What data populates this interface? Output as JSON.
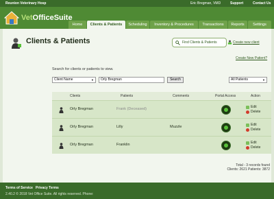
{
  "topbar": {
    "hospital": "Reunion Veterinary Hosp",
    "user": "Eric Bregman, VMD",
    "support": "Support",
    "contact": "Contact Us"
  },
  "brand": {
    "logo_text_a": "Vet",
    "logo_text_b": "OfficeSuite",
    "accent": "#4f8a34"
  },
  "tabs": [
    {
      "label": "Home"
    },
    {
      "label": "Clients & Patients",
      "active": true
    },
    {
      "label": "Scheduling"
    },
    {
      "label": "Inventory & Procedures"
    },
    {
      "label": "Transactions"
    },
    {
      "label": "Reports"
    },
    {
      "label": "Settings"
    }
  ],
  "page": {
    "title": "Clients & Patients",
    "find_button": "Find Clients & Patients",
    "create_client": "Create new client",
    "create_patient": "Create New Patient?"
  },
  "search": {
    "label": "Search for clients or patients to view.",
    "field_select": "Client Name",
    "query": "Orly Bregman",
    "button": "Search",
    "filter_select": "All Patients"
  },
  "table": {
    "headers": [
      "Clients",
      "Patients",
      "Comments",
      "Portal Access",
      "Action"
    ],
    "rows": [
      {
        "client": "Orly Bregman",
        "patient": "Frank (Deceased)",
        "comment": "",
        "deceased": true,
        "edit": "Edit",
        "delete": "Delete"
      },
      {
        "client": "Orly Bregman",
        "patient": "Lilly",
        "comment": "Muzzle",
        "deceased": false,
        "edit": "Edit",
        "delete": "Delete"
      },
      {
        "client": "Orly Bregman",
        "patient": "Franklin",
        "comment": "",
        "deceased": false,
        "edit": "Edit",
        "delete": "Delete"
      }
    ]
  },
  "totals": {
    "line1": "Total - 3 records found",
    "line2": "Clients: 2621 Patients: 3872"
  },
  "footer": {
    "terms": "Terms of Service",
    "privacy": "Privacy Terms",
    "copyright": "2.40.2 © 2018 Vet Office Suite. All rights reserved. Phone:"
  }
}
